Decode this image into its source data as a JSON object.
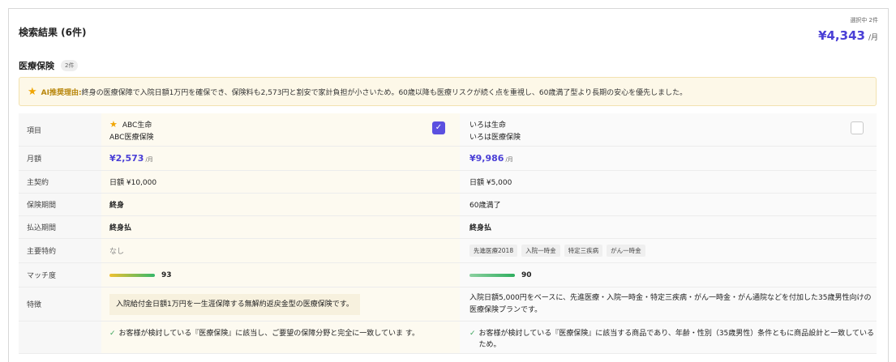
{
  "header": {
    "title": "検索結果 (6件)",
    "selected_count": "選択中 2件",
    "selected_total": "¥4,343",
    "selected_unit": "/月"
  },
  "section": {
    "title": "医療保険",
    "count": "2件"
  },
  "ai": {
    "label": "AI推奨理由:",
    "text": "終身の医療保障で入院日額1万円を確保でき、保険料も2,573円と割安で家計負担が小さいため。60歳以降も医療リスクが続く点を重視し、60歳満了型より長期の安心を優先しました。"
  },
  "table": {
    "row_labels": {
      "item": "項目",
      "monthly": "月額",
      "main_contract": "主契約",
      "period": "保険期間",
      "payment": "払込期間",
      "riders": "主要特約",
      "match": "マッチ度",
      "feature": "特徴"
    },
    "plans": [
      {
        "company": "ABC生命",
        "product": "ABC医療保険",
        "recommended": true,
        "selected": true,
        "monthly": "¥2,573",
        "unit": "/月",
        "main_contract": "日額 ¥10,000",
        "period": "終身",
        "payment": "終身払",
        "riders_none": "なし",
        "riders": [],
        "match": 93,
        "match_label": "93",
        "feature": "入院給付金日額1万円を一生涯保障する無解約返戻金型の医療保険です。",
        "reason": "お客様が検討している『医療保険』に該当し、ご要望の保障分野と完全に一致していま す。"
      },
      {
        "company": "いろは生命",
        "product": "いろは医療保険",
        "recommended": false,
        "selected": false,
        "monthly": "¥9,986",
        "unit": "/月",
        "main_contract": "日額 ¥5,000",
        "period": "60歳満了",
        "payment": "終身払",
        "riders_none": "",
        "riders": [
          "先進医療2018",
          "入院一時金",
          "特定三疾病",
          "がん一時金"
        ],
        "match": 90,
        "match_label": "90",
        "feature": "入院日額5,000円をベースに、先進医療・入院一時金・特定三疾病・がん一時金・がん通院などを付加した35歳男性向けの医療保険プランです。",
        "reason": "お客様が検討している『医療保険』に該当する商品であり、年齢・性別（35歳男性）条件ともに商品設計と一致しているため。"
      }
    ]
  },
  "colors": {
    "accent": "#4a3fd6",
    "recommend_star": "#f0a500",
    "ai_background": "#fdf8e8"
  },
  "icons": {
    "recommend": "star-icon",
    "selected": "checkbox-checked-icon",
    "unselected": "checkbox-empty-icon",
    "reason": "check-icon"
  }
}
